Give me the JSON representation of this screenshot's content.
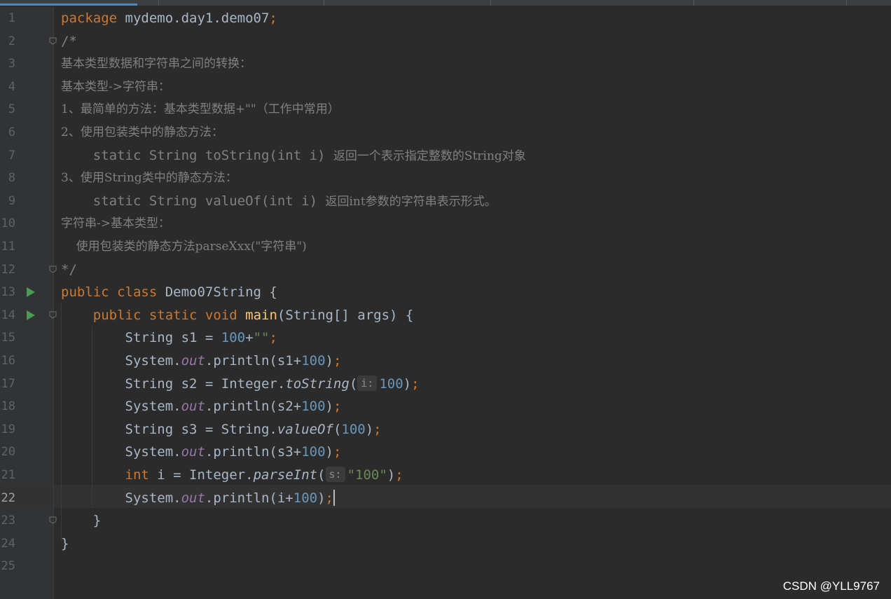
{
  "editor": {
    "current_line": 22,
    "run_lines": [
      13,
      14
    ],
    "fold_lines": [
      2,
      12,
      14,
      23
    ],
    "lines": [
      {
        "n": "1"
      },
      {
        "n": "2"
      },
      {
        "n": "3"
      },
      {
        "n": "4"
      },
      {
        "n": "5"
      },
      {
        "n": "6"
      },
      {
        "n": "7"
      },
      {
        "n": "8"
      },
      {
        "n": "9"
      },
      {
        "n": "10"
      },
      {
        "n": "11"
      },
      {
        "n": "12"
      },
      {
        "n": "13"
      },
      {
        "n": "14"
      },
      {
        "n": "15"
      },
      {
        "n": "16"
      },
      {
        "n": "17"
      },
      {
        "n": "18"
      },
      {
        "n": "19"
      },
      {
        "n": "20"
      },
      {
        "n": "21"
      },
      {
        "n": "22"
      },
      {
        "n": "23"
      },
      {
        "n": "24"
      },
      {
        "n": "25"
      }
    ],
    "code": {
      "l1": {
        "kw_package": "package",
        "pkg": " mydemo.day1.demo07",
        "semi": ";"
      },
      "l2": {
        "text": "/*"
      },
      "l3": {
        "text": "基本类型数据和字符串之间的转换："
      },
      "l4": {
        "text": "基本类型->字符串："
      },
      "l5": {
        "text": "1、最简单的方法：基本类型数据+\"\"（工作中常用）"
      },
      "l6": {
        "text": "2、使用包装类中的静态方法："
      },
      "l7": {
        "sig": "    static String toString(int i) ",
        "desc": "返回一个表示指定整数的String对象"
      },
      "l8": {
        "text": "3、使用String类中的静态方法："
      },
      "l9": {
        "sig": "    static String valueOf(int i) ",
        "desc": "返回int参数的字符串表示形式。"
      },
      "l10": {
        "text": "字符串->基本类型："
      },
      "l11": {
        "text": "    使用包装类的静态方法parseXxx(\"字符串\")"
      },
      "l12": {
        "text": "*/"
      },
      "l13": {
        "kw": "public class",
        "rest": " Demo07String {"
      },
      "l14": {
        "indent": "    ",
        "kw": "public static void",
        "sp": " ",
        "fn": "main",
        "rest": "(String[] args) {"
      },
      "l15": {
        "indent": "        ",
        "a": "String s1 = ",
        "num": "100",
        "b": "+",
        "str": "\"\"",
        "semi": ";"
      },
      "l16": {
        "indent": "        ",
        "a": "System.",
        "fld": "out",
        "b": ".println(s1+",
        "num": "100",
        "c": ")",
        "semi": ";"
      },
      "l17": {
        "indent": "        ",
        "a": "String s2 = Integer.",
        "call": "toString",
        "b": "(",
        "hint": "i:",
        "num": "100",
        "c": ")",
        "semi": ";"
      },
      "l18": {
        "indent": "        ",
        "a": "System.",
        "fld": "out",
        "b": ".println(s2+",
        "num": "100",
        "c": ")",
        "semi": ";"
      },
      "l19": {
        "indent": "        ",
        "a": "String s3 = String.",
        "call": "valueOf",
        "b": "(",
        "num": "100",
        "c": ")",
        "semi": ";"
      },
      "l20": {
        "indent": "        ",
        "a": "System.",
        "fld": "out",
        "b": ".println(s3+",
        "num": "100",
        "c": ")",
        "semi": ";"
      },
      "l21": {
        "indent": "        ",
        "kw": "int",
        "a": " i = Integer.",
        "call": "parseInt",
        "b": "(",
        "hint": "s:",
        "str": "\"100\"",
        "c": ")",
        "semi": ";"
      },
      "l22": {
        "indent": "        ",
        "a": "System.",
        "fld": "out",
        "b": ".println(i+",
        "num": "100",
        "c": ")",
        "semi": ";"
      },
      "l23": {
        "text": "    }"
      },
      "l24": {
        "text": "}"
      }
    }
  },
  "watermark": "CSDN @YLL9767"
}
